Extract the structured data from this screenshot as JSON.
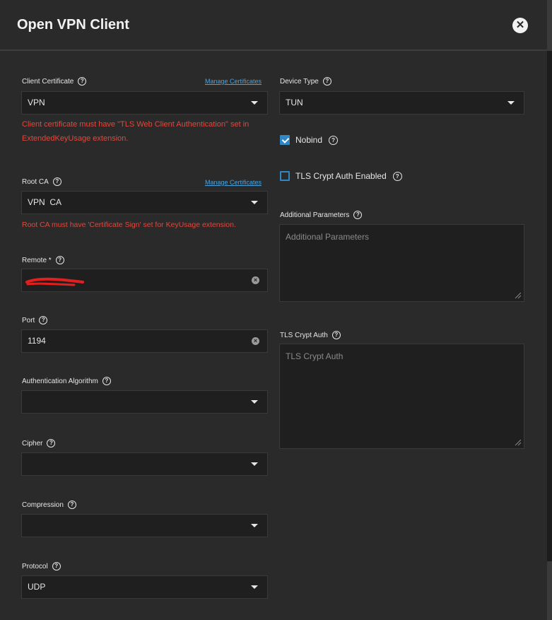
{
  "dialog": {
    "title": "Open VPN Client"
  },
  "left": {
    "client_certificate": {
      "label": "Client Certificate",
      "manage_link": "Manage Certificates",
      "value": "VPN",
      "error": "Client certificate must have \"TLS Web Client Authentication\" set in ExtendedKeyUsage extension."
    },
    "root_ca": {
      "label": "Root CA",
      "manage_link": "Manage Certificates",
      "value": "VPN  CA",
      "error": "Root CA must have 'Certificate Sign' set for KeyUsage extension."
    },
    "remote": {
      "label": "Remote *",
      "value": ""
    },
    "port": {
      "label": "Port",
      "value": "1194"
    },
    "auth_algorithm": {
      "label": "Authentication Algorithm",
      "value": ""
    },
    "cipher": {
      "label": "Cipher",
      "value": ""
    },
    "compression": {
      "label": "Compression",
      "value": ""
    },
    "protocol": {
      "label": "Protocol",
      "value": "UDP"
    }
  },
  "right": {
    "device_type": {
      "label": "Device Type",
      "value": "TUN"
    },
    "nobind": {
      "label": "Nobind",
      "checked": true
    },
    "tls_crypt_enabled": {
      "label": "TLS Crypt Auth Enabled",
      "checked": false
    },
    "additional_params": {
      "label": "Additional Parameters",
      "placeholder": "Additional Parameters"
    },
    "tls_crypt_auth": {
      "label": "TLS Crypt Auth",
      "placeholder": "TLS Crypt Auth"
    }
  },
  "icons": {
    "help": "?",
    "close": "✕",
    "clear": "×"
  },
  "colors": {
    "background": "#2a2a2a",
    "field": "#1f1f1f",
    "error": "#e0483d",
    "link": "#4aa3df",
    "checkbox": "#2f87c5",
    "redaction": "#e21f1f"
  }
}
